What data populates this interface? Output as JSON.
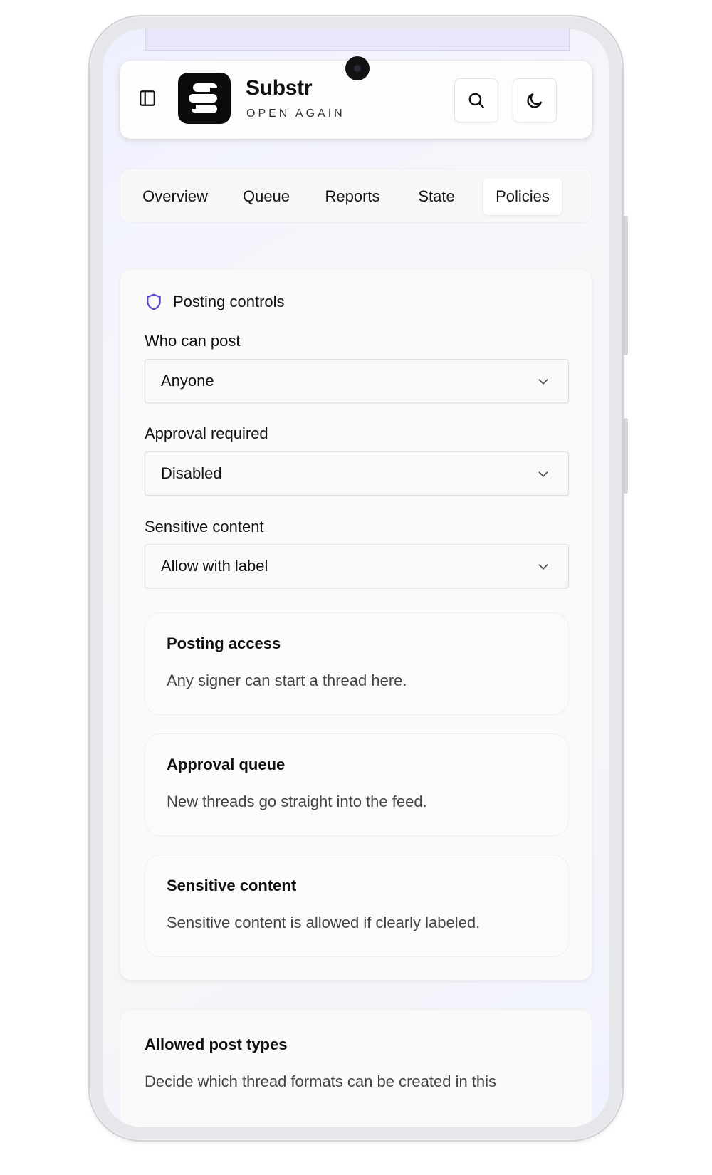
{
  "header": {
    "brand_name": "Substr",
    "brand_tagline": "OPEN AGAIN",
    "sidebar_toggle_icon": "sidebar-icon",
    "search_icon": "search-icon",
    "theme_icon": "moon-icon"
  },
  "tabs": [
    {
      "label": "Overview",
      "active": false
    },
    {
      "label": "Queue",
      "active": false
    },
    {
      "label": "Reports",
      "active": false
    },
    {
      "label": "State",
      "active": false
    },
    {
      "label": "Policies",
      "active": true
    }
  ],
  "posting_controls": {
    "title": "Posting controls",
    "icon": "shield-icon",
    "accent": "#5b3fd1",
    "who_can_post": {
      "label": "Who can post",
      "value": "Anyone"
    },
    "approval_required": {
      "label": "Approval required",
      "value": "Disabled"
    },
    "sensitive_content": {
      "label": "Sensitive content",
      "value": "Allow with label"
    },
    "info_cards": [
      {
        "title": "Posting access",
        "description": "Any signer can start a thread here."
      },
      {
        "title": "Approval queue",
        "description": "New threads go straight into the feed."
      },
      {
        "title": "Sensitive content",
        "description": "Sensitive content is allowed if clearly labeled."
      }
    ]
  },
  "allowed_post_types": {
    "title": "Allowed post types",
    "description": "Decide which thread formats can be created in this"
  }
}
